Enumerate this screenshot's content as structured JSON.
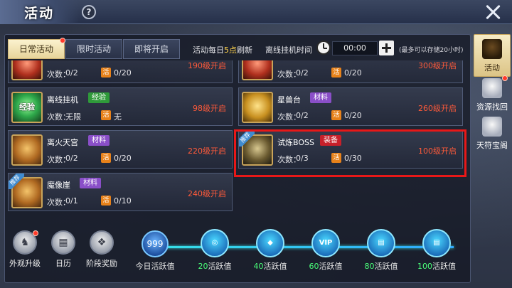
{
  "header": {
    "title": "活动",
    "help_symbol": "?"
  },
  "tabs": [
    {
      "label": "日常活动",
      "active": true,
      "badge": true
    },
    {
      "label": "限时活动",
      "active": false,
      "badge": false
    },
    {
      "label": "即将开启",
      "active": false,
      "badge": false
    }
  ],
  "refresh": {
    "prefix": "活动每日",
    "hour": "5点",
    "suffix": "刷新"
  },
  "offline": {
    "label": "离线挂机时间",
    "time": "00:00",
    "note": "(最多可以存储20小时)"
  },
  "huo_symbol": "活",
  "count_label": "次数：",
  "cards": [
    {
      "name": "",
      "tag": "",
      "count": "0/2",
      "activity": "0/20",
      "level": "190级开启",
      "icon": "red-relic-icon",
      "recommended": false
    },
    {
      "name": "",
      "tag": "",
      "count": "0/2",
      "activity": "0/20",
      "level": "300级开启",
      "icon": "red-relic-icon",
      "recommended": false
    },
    {
      "name": "离线挂机",
      "tag": "经验",
      "tag_color": "green",
      "count": "无限",
      "activity": "无",
      "level": "98级开启",
      "icon": "exp-orb-icon",
      "icon_text": "经验",
      "recommended": false
    },
    {
      "name": "星兽台",
      "tag": "材料",
      "tag_color": "purple",
      "count": "0/2",
      "activity": "0/20",
      "level": "260级开启",
      "icon": "star-beast-icon",
      "recommended": false
    },
    {
      "name": "离火天宫",
      "tag": "材料",
      "tag_color": "purple",
      "count": "0/2",
      "activity": "0/20",
      "level": "220级开启",
      "icon": "fire-palace-icon",
      "recommended": false
    },
    {
      "name": "试炼BOSS",
      "tag": "装备",
      "tag_color": "red",
      "count": "0/3",
      "activity": "0/30",
      "level": "100级开启",
      "icon": "boss-armor-icon",
      "recommended": true
    },
    {
      "name": "魔像崖",
      "tag": "材料",
      "tag_color": "purple",
      "count": "0/1",
      "activity": "0/10",
      "level": "240级开启",
      "icon": "golem-cliff-icon",
      "recommended": true
    }
  ],
  "recommend_badge": "推荐",
  "bottom_buttons": [
    {
      "label": "外观升级",
      "icon": "appearance-icon",
      "badge": true
    },
    {
      "label": "日历",
      "icon": "calendar-icon",
      "badge": false
    },
    {
      "label": "阶段奖励",
      "icon": "gift-icon",
      "badge": false
    }
  ],
  "today": {
    "value": "999",
    "label": "今日活跃值"
  },
  "milestones": [
    {
      "num": "20",
      "text": "活跃值",
      "icon": "coins-icon"
    },
    {
      "num": "40",
      "text": "活跃值",
      "icon": "green-gem-icon"
    },
    {
      "num": "60",
      "text": "活跃值",
      "icon": "vip-card-icon",
      "icon_text": "VIP"
    },
    {
      "num": "80",
      "text": "活跃值",
      "icon": "scroll-book-icon"
    },
    {
      "num": "100",
      "text": "活跃值",
      "icon": "scroll-book-icon"
    }
  ],
  "sidebar": [
    {
      "label": "活动",
      "active": true,
      "badge": false,
      "icon": "activity-icon"
    },
    {
      "label": "资源找回",
      "active": false,
      "badge": true,
      "icon": "resource-recover-icon"
    },
    {
      "label": "天符宝阁",
      "active": false,
      "badge": false,
      "icon": "treasure-pavilion-icon"
    }
  ],
  "colors": {
    "level_text": "#ff5a3a",
    "milestone_num": "#4aff7a",
    "highlight": "#e81818",
    "active_tab": "#fbf2cf"
  }
}
